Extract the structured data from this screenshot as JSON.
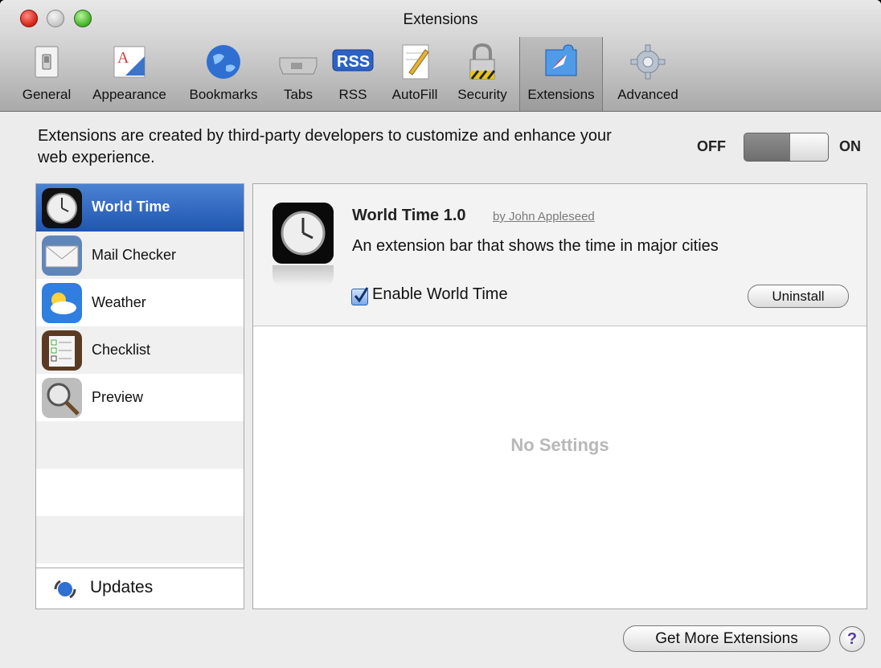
{
  "window": {
    "title": "Extensions"
  },
  "toolbar": {
    "items": [
      {
        "label": "General",
        "icon": "light-switch-icon"
      },
      {
        "label": "Appearance",
        "icon": "font-icon"
      },
      {
        "label": "Bookmarks",
        "icon": "globe-icon"
      },
      {
        "label": "Tabs",
        "icon": "tabs-icon"
      },
      {
        "label": "RSS",
        "icon": "rss-icon"
      },
      {
        "label": "AutoFill",
        "icon": "pencil-form-icon"
      },
      {
        "label": "Security",
        "icon": "lock-icon"
      },
      {
        "label": "Extensions",
        "icon": "puzzle-compass-icon",
        "selected": true
      },
      {
        "label": "Advanced",
        "icon": "gear-icon"
      }
    ]
  },
  "header": {
    "description": "Extensions are created by third-party developers to customize and enhance your web experience.",
    "off_label": "OFF",
    "on_label": "ON"
  },
  "sidebar": {
    "items": [
      {
        "label": "World Time",
        "icon": "clock-icon",
        "selected": true
      },
      {
        "label": "Mail Checker",
        "icon": "envelope-icon"
      },
      {
        "label": "Weather",
        "icon": "weather-icon"
      },
      {
        "label": "Checklist",
        "icon": "checklist-icon"
      },
      {
        "label": "Preview",
        "icon": "magnifier-icon"
      }
    ],
    "updates_label": "Updates"
  },
  "detail": {
    "name": "World Time 1.0",
    "author": "by John Appleseed",
    "description": "An extension bar that shows the time in major cities",
    "enable_label": "Enable World Time",
    "enabled": true,
    "uninstall_label": "Uninstall",
    "empty_text": "No Settings"
  },
  "footer": {
    "get_more_label": "Get More Extensions",
    "help_label": "?"
  }
}
